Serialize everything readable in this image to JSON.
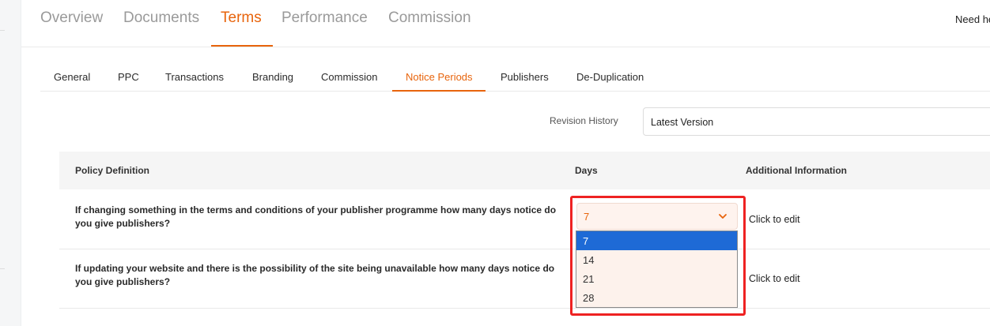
{
  "top_tabs": [
    "Overview",
    "Documents",
    "Terms",
    "Performance",
    "Commission"
  ],
  "top_tab_active": "Terms",
  "help_text": "Need he",
  "sub_tabs": [
    "General",
    "PPC",
    "Transactions",
    "Branding",
    "Commission",
    "Notice Periods",
    "Publishers",
    "De-Duplication"
  ],
  "sub_tab_active": "Notice Periods",
  "revision": {
    "label": "Revision History",
    "value": "Latest Version"
  },
  "table": {
    "headers": [
      "Policy Definition",
      "Days",
      "Additional Information"
    ],
    "rows": [
      {
        "question": "If changing something in the terms and conditions of your publisher programme how many days notice do you give publishers?",
        "days": "7",
        "info": "Click to edit"
      },
      {
        "question": "If updating your website and there is the possibility of the site being unavailable how many days notice do you give publishers?",
        "info": "Click to edit"
      }
    ]
  },
  "days_dropdown": {
    "options": [
      "7",
      "14",
      "21",
      "28"
    ],
    "selected": "7"
  },
  "colors": {
    "accent": "#e8640c",
    "option_selected": "#1e6ad6",
    "highlight": "#ee2222"
  },
  "icons": {
    "days_select": "chevron-down-icon"
  }
}
